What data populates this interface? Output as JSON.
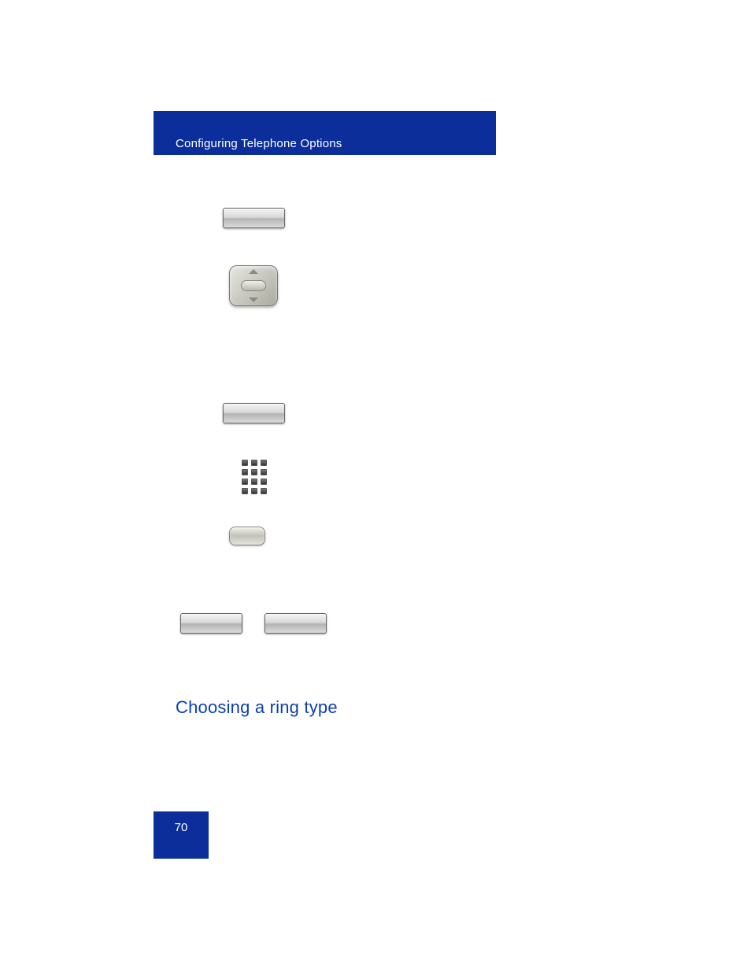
{
  "header": {
    "title": "Configuring Telephone Options"
  },
  "section": {
    "heading": "Choosing a ring type"
  },
  "footer": {
    "page": "70"
  },
  "icons": {
    "softkey1": "screen-contrast-softkey",
    "navpad": "navigation-pad",
    "softkey2": "or-softkey",
    "keypad": "dialpad",
    "enter": "enter-button",
    "softkey_left": "select-softkey",
    "softkey_right": "cancel-softkey"
  }
}
